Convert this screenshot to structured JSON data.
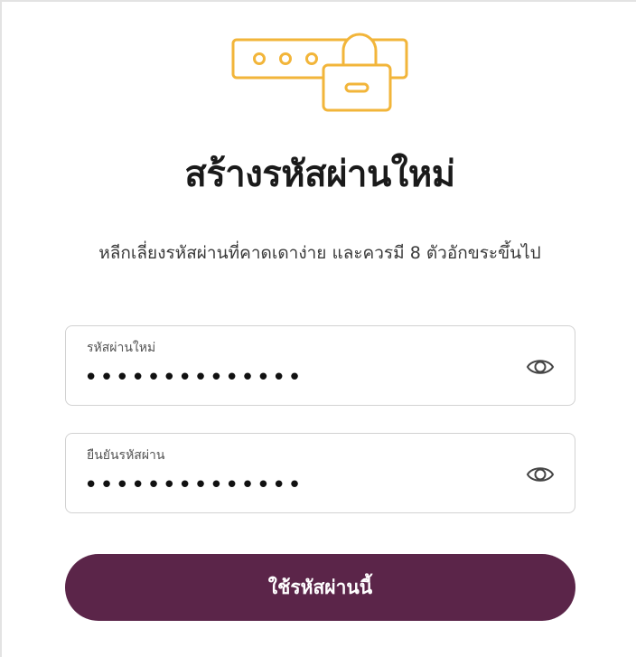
{
  "page": {
    "title": "สร้างรหัสผ่านใหม่",
    "subtitle": "หลีกเลี่ยงรหัสผ่านที่คาดเดาง่าย และควรมี 8 ตัวอักขระขึ้นไป"
  },
  "icons": {
    "hero": "password-lock-icon",
    "toggle": "eye-icon"
  },
  "colors": {
    "accent": "#F2B53A",
    "button": "#5B2549",
    "button_text": "#FFFFFF"
  },
  "form": {
    "new_password": {
      "label": "รหัสผ่านใหม่",
      "value": "••••••••••••••"
    },
    "confirm_password": {
      "label": "ยืนยันรหัสผ่าน",
      "value": "••••••••••••••"
    },
    "submit_label": "ใช้รหัสผ่านนี้"
  }
}
